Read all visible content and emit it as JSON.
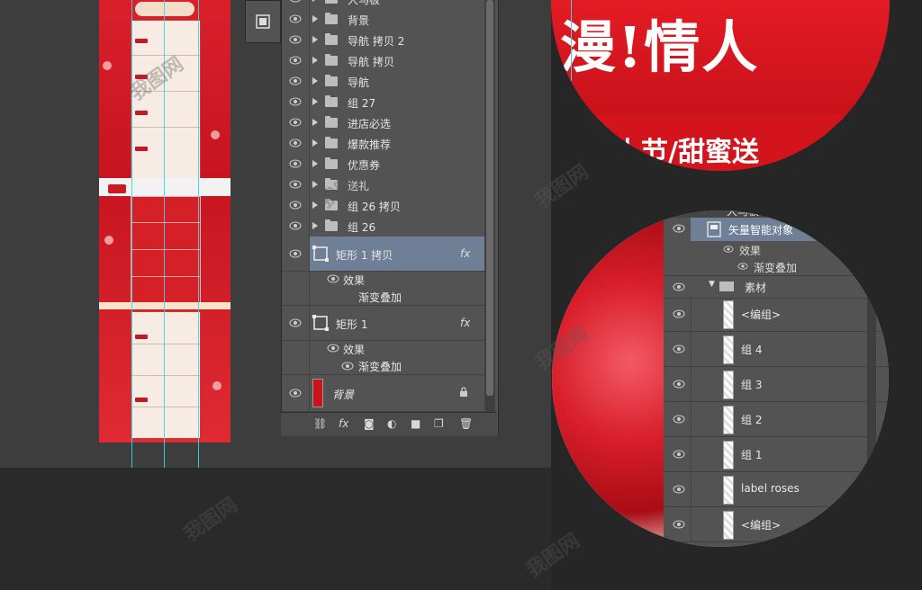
{
  "layers_panel": {
    "rows": [
      {
        "name": "大马板"
      },
      {
        "name": "背景"
      },
      {
        "name": "导航 拷贝 2"
      },
      {
        "name": "导航 拷贝"
      },
      {
        "name": "导航"
      },
      {
        "name": "组 27"
      },
      {
        "name": "进店必选"
      },
      {
        "name": "爆款推荐"
      },
      {
        "name": "优惠券"
      },
      {
        "name": "送礼"
      },
      {
        "name": "组 26 拷贝"
      },
      {
        "name": "组 26"
      }
    ],
    "shape_layer_1": {
      "name": "矩形 1 拷贝",
      "fx": "fx",
      "effect": "效果",
      "effect_item": "渐变叠加"
    },
    "shape_layer_2": {
      "name": "矩形 1",
      "fx": "fx",
      "effect": "效果",
      "effect_item": "渐变叠加"
    },
    "background_layer": {
      "name": "背景",
      "thumb_color": "#c8141c"
    },
    "footer_icons": [
      "link-icon",
      "fx-icon",
      "mask-icon",
      "adjustment-icon",
      "folder-icon",
      "new-layer-icon",
      "trash-icon"
    ],
    "footer_fx": "fx"
  },
  "zoom_top": {
    "banner_text": "漫!情人",
    "slogan": "情人节/甜蜜送"
  },
  "zoom_bottom": {
    "header_label": "大马板",
    "smart_object": "矢量智能对象",
    "effect": "效果",
    "effect_item": "渐变叠加",
    "group_folder": "素材",
    "items": [
      "<编组>",
      "组 4",
      "组 3",
      "组 2",
      "组 1",
      "label roses",
      "<编组>"
    ]
  },
  "watermark_text": "我图网",
  "colors": {
    "accent_red": "#d4141c",
    "selected_row": "#6e7f96",
    "panel": "#535353",
    "guide": "#38d6e6"
  }
}
